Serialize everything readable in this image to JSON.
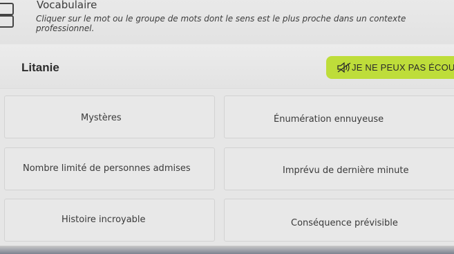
{
  "header": {
    "title": "Vocabulaire",
    "instruction": "Cliquer sur le mot ou le groupe de mots dont le sens est le plus proche dans un contexte professionnel."
  },
  "question": {
    "word": "Litanie",
    "listen_button_label": "JE NE PEUX PAS ÉCOUTER",
    "listen_icon": "speaker-muted-icon"
  },
  "choices": [
    "Mystères",
    "Énumération ennuyeuse",
    "Nombre limité de personnes admises",
    "Imprévu de dernière minute",
    "Histoire incroyable",
    "Conséquence prévisible"
  ],
  "colors": {
    "accent": "#bedd3a",
    "background": "#e6e6e6"
  }
}
